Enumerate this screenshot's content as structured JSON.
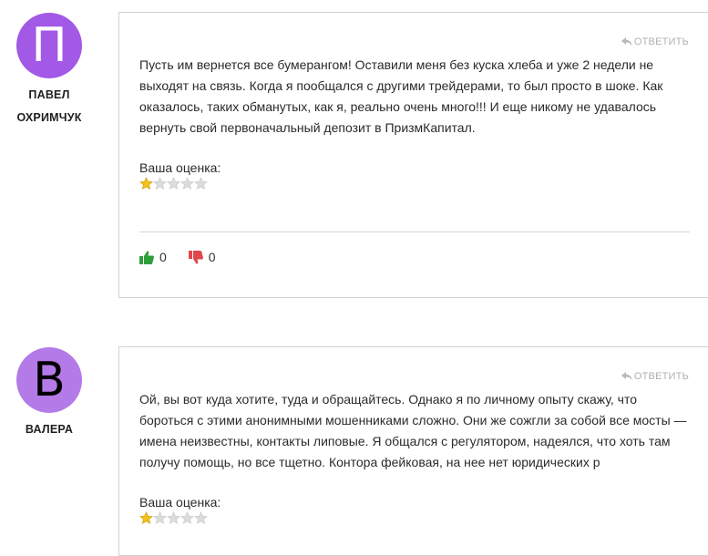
{
  "comments": [
    {
      "avatar_letter": "П",
      "avatar_color": "#a259e6",
      "avatar_text_color": "#ffffff",
      "author_line1": "ПАВЕЛ",
      "author_line2": "ОХРИМЧУК",
      "reply_label": "ОТВЕТИТЬ",
      "text_lines": [
        "Пусть им вернется все бумерангом! Оставили меня без куска хлеба и уже 2 недели не",
        "выходят на связь. Когда я пообщался с другими трейдерами, то был просто в шоке. Как",
        "оказалось, таких обманутых, как я, реально очень много!!! И еще никому не удавалось",
        "вернуть свой первоначальный депозит в ПризмКапитал."
      ],
      "rating_label": "Ваша оценка:",
      "rating": 1,
      "rating_max": 5,
      "likes": "0",
      "dislikes": "0"
    },
    {
      "avatar_letter": "В",
      "avatar_color": "#b47ae8",
      "avatar_text_color": "#000000",
      "author_line1": "ВАЛЕРА",
      "reply_label": "ОТВЕТИТЬ",
      "text_lines": [
        "Ой, вы вот куда хотите, туда и обращайтесь. Однако я по личному опыту скажу, что",
        "бороться с этими анонимными мошенниками сложно. Они же сожгли за собой все мосты —",
        "имена неизвестны, контакты липовые. Я общался с регулятором, надеялся, что хоть там",
        "получу помощь, но все тщетно. Контора фейковая, на нее нет юридических р"
      ],
      "rating_label": "Ваша оценка:",
      "rating": 1,
      "rating_max": 5
    }
  ],
  "colors": {
    "like": "#2e9e3a",
    "dislike": "#e0474c",
    "star_filled": "#f2c21a",
    "star_empty": "#dcdcdc"
  }
}
